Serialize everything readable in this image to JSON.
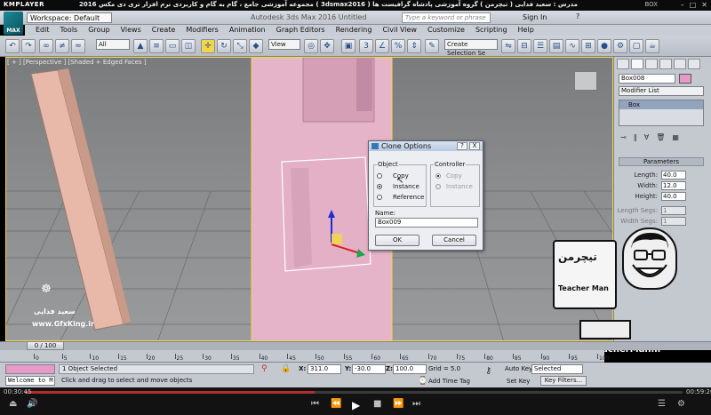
{
  "player": {
    "logo": "KMPLAYER",
    "caption": "مجموعه آموزشی جامع ، گام به گام و کاربردی نرم افزار تری دی مکس 2016 ( 3dsmax2016 )  مدرس : سعید فدایی ( تیچرمن ) گروه آموزشی پادشاه گرافیست ها",
    "box_label": "BOX",
    "time_current": "00:30:45",
    "time_total": "00:59:20",
    "seek_progress": 0.44
  },
  "max": {
    "logo": "MAX",
    "workspace": "Workspace: Default",
    "app_title": "Autodesk 3ds Max 2016    Untitled",
    "search_placeholder": "Type a keyword or phrase",
    "signin": "Sign In",
    "help_icon": "?"
  },
  "menus": [
    "Edit",
    "Tools",
    "Group",
    "Views",
    "Create",
    "Modifiers",
    "Animation",
    "Graph Editors",
    "Rendering",
    "Civil View",
    "Customize",
    "Scripting",
    "Help"
  ],
  "toolbar": {
    "filter": "All",
    "ref_coord": "View",
    "selection_set": "Create Selection Se"
  },
  "viewport": {
    "label": "[ + ] [Perspective ] [Shaded + Edged Faces ]"
  },
  "command_panel": {
    "object_name": "Box008",
    "object_color": "#e79ac8",
    "modifier_list": "Modifier List",
    "stack_item": "Box",
    "rollout": "Parameters",
    "params": [
      {
        "label": "Length:",
        "value": "40.0",
        "enabled": true
      },
      {
        "label": "Width:",
        "value": "12.0",
        "enabled": true
      },
      {
        "label": "Height:",
        "value": "40.0",
        "enabled": true
      },
      {
        "label": "Length Segs:",
        "value": "1",
        "enabled": false
      },
      {
        "label": "Width Segs:",
        "value": "1",
        "enabled": false
      }
    ]
  },
  "clone_dialog": {
    "title": "Clone Options",
    "help": "?",
    "close": "X",
    "object_group": "Object",
    "object_options": [
      {
        "label": "Copy",
        "selected": false,
        "enabled": true
      },
      {
        "label": "Instance",
        "selected": true,
        "enabled": true
      },
      {
        "label": "Reference",
        "selected": false,
        "enabled": true
      }
    ],
    "controller_group": "Controller",
    "controller_options": [
      {
        "label": "Copy",
        "selected": true,
        "enabled": false
      },
      {
        "label": "Instance",
        "selected": false,
        "enabled": false
      }
    ],
    "name_label": "Name:",
    "name_value": "Box009",
    "ok": "OK",
    "cancel": "Cancel"
  },
  "timeline": {
    "thumb": "0 / 100",
    "ticks": [
      "0",
      "5",
      "10",
      "15",
      "20",
      "25",
      "30",
      "35",
      "40",
      "45",
      "50",
      "55",
      "60",
      "65",
      "70",
      "75",
      "80",
      "85",
      "90",
      "95",
      "100"
    ]
  },
  "status": {
    "maxscript": "Welcome to M.",
    "selection": "1 Object Selected",
    "prompt": "Click and drag to select and move objects",
    "x_label": "X:",
    "x": "311.0",
    "y_label": "Y:",
    "y": "-30.0",
    "z_label": "Z:",
    "z": "100.0",
    "grid": "Grid = 5.0",
    "add_time_tag": "Add Time Tag",
    "auto_key": "Auto Key",
    "set_key": "Set Key",
    "selected": "Selected",
    "key_filters": "Key Filters..."
  },
  "watermarks": {
    "gfx_name": "سعید فدایی",
    "gfx_site": "www.GfxKing.ir",
    "teacher_farsi": "تیچرمن",
    "teacher_name": "Teacher Man",
    "teacher_site": "www.TeacherMan.ir"
  }
}
